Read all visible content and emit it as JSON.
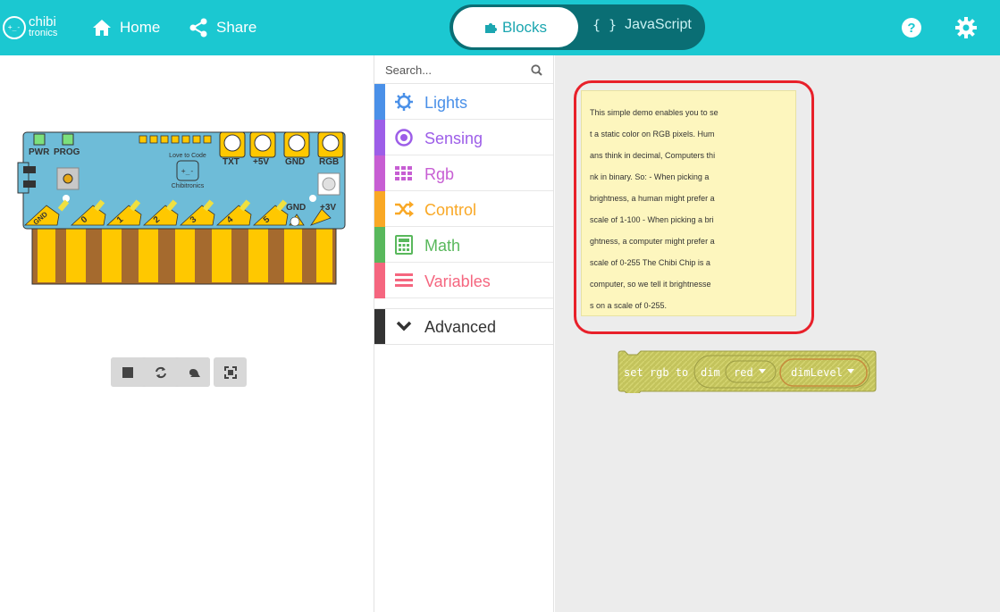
{
  "header": {
    "logo_line1": "chibi",
    "logo_line2": "tronics",
    "home_label": "Home",
    "share_label": "Share",
    "blocks_label": "Blocks",
    "javascript_label": "JavaScript",
    "javascript_braces": "{ }",
    "colors": {
      "background": "#1bc8d1",
      "toggle_bg": "#0a6e74"
    }
  },
  "board": {
    "pwr": "PWR",
    "prog": "PROG",
    "love_to_code": "Love to Code",
    "face": "+_-",
    "brand": "Chibitronics",
    "top_pads": [
      "TXT",
      "+5V",
      "GND",
      "RGB"
    ],
    "right_labels": [
      "GND",
      "+3V"
    ],
    "bottom_pads": [
      "GND",
      "0",
      "1",
      "2",
      "3",
      "4",
      "5"
    ]
  },
  "toolbox": {
    "search_placeholder": "Search...",
    "categories": [
      {
        "label": "Lights",
        "color": "#4a90e8",
        "icon": "lights-icon"
      },
      {
        "label": "Sensing",
        "color": "#9d5ee8",
        "icon": "sensing-icon"
      },
      {
        "label": "Rgb",
        "color": "#c75ed3",
        "icon": "rgb-icon"
      },
      {
        "label": "Control",
        "color": "#f9a825",
        "icon": "control-icon"
      },
      {
        "label": "Math",
        "color": "#59b85c",
        "icon": "math-icon"
      },
      {
        "label": "Variables",
        "color": "#f5667f",
        "icon": "variables-icon"
      }
    ],
    "advanced_label": "Advanced"
  },
  "workspace": {
    "comment_lines": [
      "This simple demo enables you to se",
      "t a static color on RGB pixels. Hum",
      "ans think in decimal, Computers thi",
      "nk in binary. So: - When picking a",
      "brightness, a human might prefer a",
      "scale of 1-100 - When picking a bri",
      "ghtness, a computer might prefer a",
      "scale of 0-255 The Chibi Chip is a",
      "computer, so we tell it brightnesse",
      "s on a scale of 0-255."
    ],
    "block": {
      "prefix": "set rgb to",
      "fn": "dim",
      "arg1": "red",
      "arg2": "dimLevel",
      "color": "#c3c35c"
    }
  }
}
